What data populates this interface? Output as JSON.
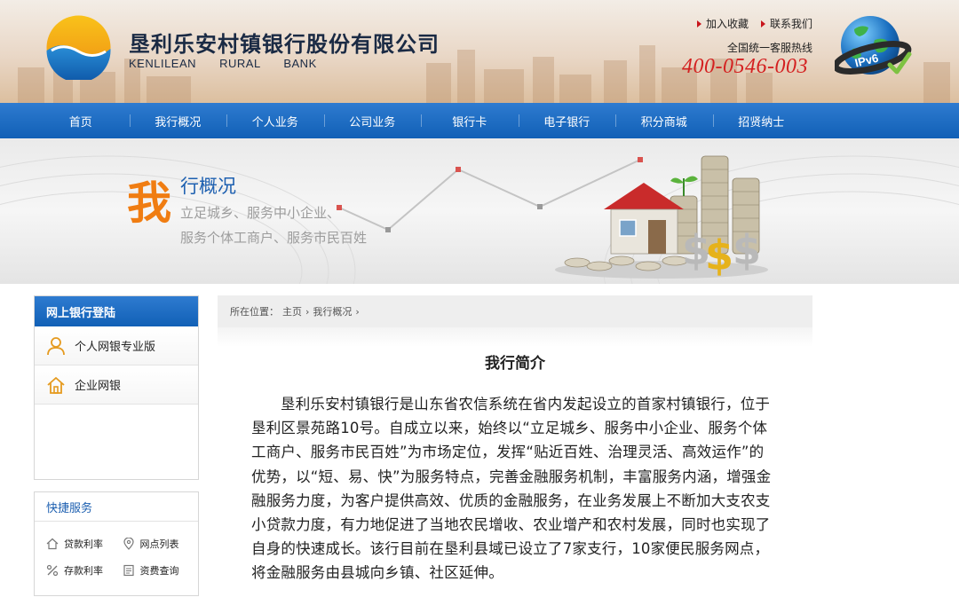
{
  "header": {
    "bank_name_cn": "垦利乐安村镇银行股份有限公司",
    "bank_name_en": "KENLILEAN RURAL BANK",
    "top_links": [
      {
        "label": "加入收藏"
      },
      {
        "label": "联系我们"
      }
    ],
    "hotline_label": "全国统一客服热线",
    "hotline_number": "400-0546-003",
    "ipv6_badge": "IPv6",
    "colors": {
      "hotline": "#d42020",
      "accent_red": "#c8161d"
    }
  },
  "nav": {
    "items": [
      {
        "label": "首页"
      },
      {
        "label": "我行概况"
      },
      {
        "label": "个人业务"
      },
      {
        "label": "公司业务"
      },
      {
        "label": "银行卡"
      },
      {
        "label": "电子银行"
      },
      {
        "label": "积分商城"
      },
      {
        "label": "招贤纳士"
      }
    ],
    "color": "#1e6fc4"
  },
  "banner": {
    "big_char": "我",
    "title_rest": "行概况",
    "line1": "立足城乡、服务中小企业、",
    "line2": "服务个体工商户、服务市民百姓",
    "colors": {
      "big_char": "#f07d12",
      "title": "#1c5fb0"
    }
  },
  "sidebar": {
    "login_title": "网上银行登陆",
    "login_items": [
      {
        "label": "个人网银专业版",
        "icon": "user-icon"
      },
      {
        "label": "企业网银",
        "icon": "home-icon"
      }
    ],
    "quick_title": "快捷服务",
    "quick_items": [
      {
        "label": "贷款利率",
        "icon": "house-outline-icon"
      },
      {
        "label": "网点列表",
        "icon": "location-pin-icon"
      },
      {
        "label": "存款利率",
        "icon": "percent-icon"
      },
      {
        "label": "资费查询",
        "icon": "document-icon"
      }
    ]
  },
  "main": {
    "breadcrumb": {
      "prefix": "所在位置：",
      "items": [
        "主页",
        "我行概况"
      ]
    },
    "title": "我行简介",
    "body": "垦利乐安村镇银行是山东省农信系统在省内发起设立的首家村镇银行，位于垦利区景苑路10号。自成立以来，始终以“立足城乡、服务中小企业、服务个体工商户、服务市民百姓”为市场定位，发挥“贴近百姓、治理灵活、高效运作”的优势，以“短、易、快”为服务特点，完善金融服务机制，丰富服务内涵，增强金融服务力度，为客户提供高效、优质的金融服务，在业务发展上不断加大支农支小贷款力度，有力地促进了当地农民增收、农业增产和农村发展，同时也实现了自身的快速成长。该行目前在垦利县域已设立了7家支行，10家便民服务网点，将金融服务由县城向乡镇、社区延伸。"
  }
}
